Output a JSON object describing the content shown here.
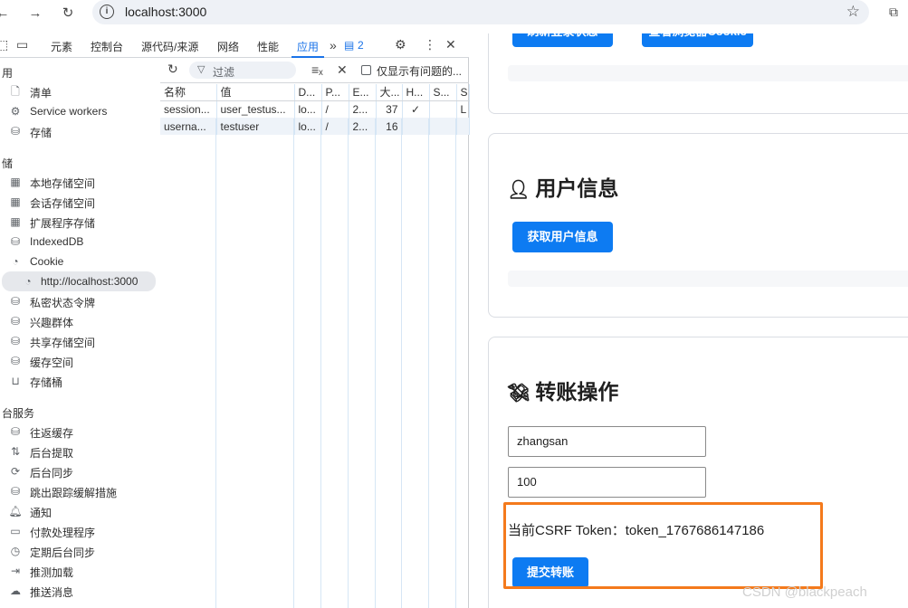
{
  "browser": {
    "url": "localhost:3000",
    "back_icon": "arrow-left",
    "forward_icon": "arrow-right",
    "reload_icon": "reload",
    "bookmark_icon": "star"
  },
  "devtools": {
    "tabs": [
      "元素",
      "控制台",
      "源代码/来源",
      "网络",
      "性能",
      "应用"
    ],
    "active_tab": "应用",
    "issues_count": "2",
    "sidebar": {
      "section_app": "用",
      "app_items": [
        "清单",
        "Service workers",
        "存储"
      ],
      "section_storage": "储",
      "storage_items": [
        "本地存储空间",
        "会话存储空间",
        "扩展程序存储",
        "IndexedDB",
        "Cookie"
      ],
      "cookie_child": "http://localhost:3000",
      "storage_items_after": [
        "私密状态令牌",
        "兴趣群体",
        "共享存储空间",
        "缓存空间",
        "存储桶"
      ],
      "section_bg": "台服务",
      "bg_items": [
        "往返缓存",
        "后台提取",
        "后台同步",
        "跳出跟踪缓解措施",
        "通知",
        "付款处理程序",
        "定期后台同步",
        "推测加载",
        "推送消息"
      ]
    },
    "toolbar": {
      "filter_placeholder": "过滤",
      "only_issues_label": "仅显示有问题的..."
    },
    "cookie_table": {
      "headers": [
        "名称",
        "值",
        "D...",
        "P...",
        "E...",
        "大...",
        "H...",
        "S...",
        "S"
      ],
      "rows": [
        [
          "session...",
          "user_testus...",
          "lo...",
          "/",
          "2...",
          "37",
          "✓",
          "",
          "L"
        ],
        [
          "userna...",
          "testuser",
          "lo...",
          "/",
          "2...",
          "16",
          "",
          "",
          ""
        ]
      ]
    }
  },
  "page": {
    "top_buttons": [
      "刷新登录状态",
      "查看浏览器Cookie"
    ],
    "user_card": {
      "title": "用户信息",
      "button": "获取用户信息"
    },
    "transfer_card": {
      "title": "转账操作",
      "to_value": "zhangsan",
      "amount_value": "100",
      "csrf_text": "当前CSRF Token：token_1767686147186",
      "submit_button": "提交转账"
    },
    "watermark": "CSDN @blackpeach"
  },
  "colors": {
    "primary_button": "#0d7bf2",
    "highlight_border": "#f47a1c",
    "devtools_active": "#1a73e8"
  }
}
